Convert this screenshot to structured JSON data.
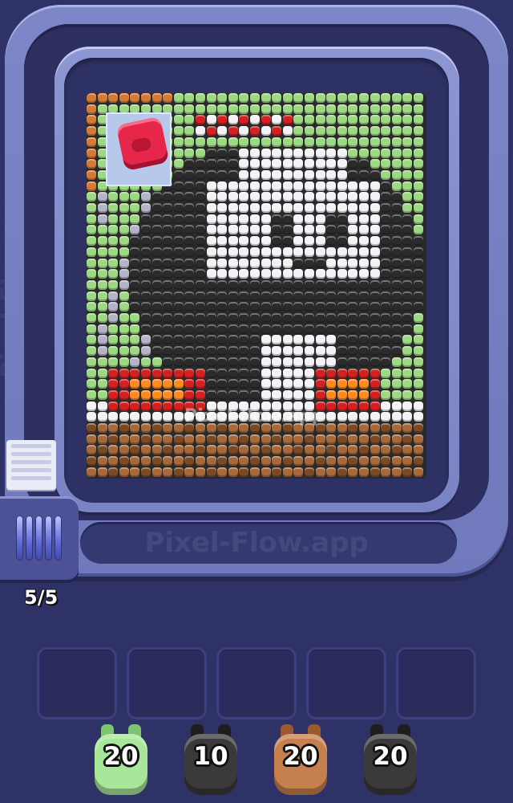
{
  "watermark": "Pixel-Flow.app",
  "board_watermark": "Pixel-flow.app",
  "counter": "5/5",
  "colors": {
    "background": "#2f3266",
    "grass": "#9dd882",
    "white": "#f2f2f7",
    "black": "#2b2b2b",
    "red": "#d42020",
    "orange": "#ff8a1e",
    "brown": "#a8693a",
    "gray": "#b4b4c8",
    "crate": "#d57a34"
  },
  "shooter": {
    "color": "red",
    "icon": "pig-icon"
  },
  "slots": [
    "",
    "",
    "",
    "",
    ""
  ],
  "pigs": [
    {
      "color": "green",
      "ammo": "20"
    },
    {
      "color": "black",
      "ammo": "10"
    },
    {
      "color": "brown",
      "ammo": "20"
    },
    {
      "color": "black",
      "ammo": "20"
    }
  ]
}
